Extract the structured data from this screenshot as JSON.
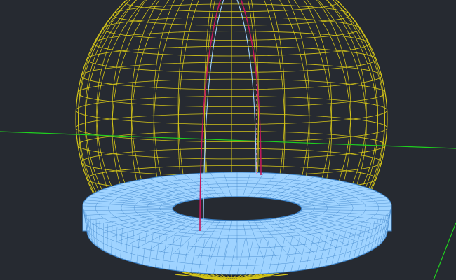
{
  "viewport": {
    "background": "#262a31",
    "visual_style": "wireframe"
  },
  "colors": {
    "sphere_wireframe": "#d4c519",
    "torus_fill": "#9fd3ff",
    "torus_mesh": "#3c82c8",
    "axis": "#1fd01f",
    "profile_outer": "#c2185b",
    "profile_inner": "#9fd3ff",
    "profile_accent": "#ff6fb4"
  },
  "objects": [
    {
      "name": "sphere",
      "kind": "wireframe-sphere"
    },
    {
      "name": "torus",
      "kind": "mesh-torus"
    },
    {
      "name": "revolve-profile",
      "kind": "polyline"
    },
    {
      "name": "ucs-axes",
      "kind": "axis-lines"
    }
  ]
}
